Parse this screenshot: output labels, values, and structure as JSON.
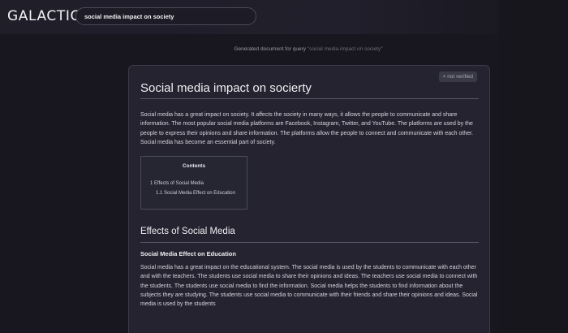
{
  "app": {
    "logo": "GALACTICA"
  },
  "search": {
    "value": "social media impact on society"
  },
  "caption": {
    "prefix": "Generated document for query",
    "query": "\"social media impact on society\""
  },
  "document": {
    "badge": "× not verified",
    "title": "Social media impact on socierty",
    "intro": "Social media has a great impact on society. It affects the society in many ways, it allows the people to communicate and share information. The most popular social media platforms are Facebook, Instagram, Twitter, and YouTube. The platforms are used by the people to express their opinions and share information. The platforms allow the people to connect and communicate with each other. Social media has become an essential part of society.",
    "contents": {
      "title": "Contents",
      "item1": "1 Effects of Social Media",
      "item1_1": "1.1 Social Media Effect on Education"
    },
    "section_title": "Effects of Social Media",
    "subsection_title": "Social Media Effect on Education",
    "subsection_text": "Social media has a great impact on the educational system. The social media is used by the students to communicate with each other and with the teachers. The students use social media to share their opinions and ideas. The teachers use social media to connect with the students. The students use social media to find the information. Social media helps the students to find information about the subjects they are studying. The students use social media to communicate with their friends and share their opinions and ideas. Social media is used by the students"
  }
}
